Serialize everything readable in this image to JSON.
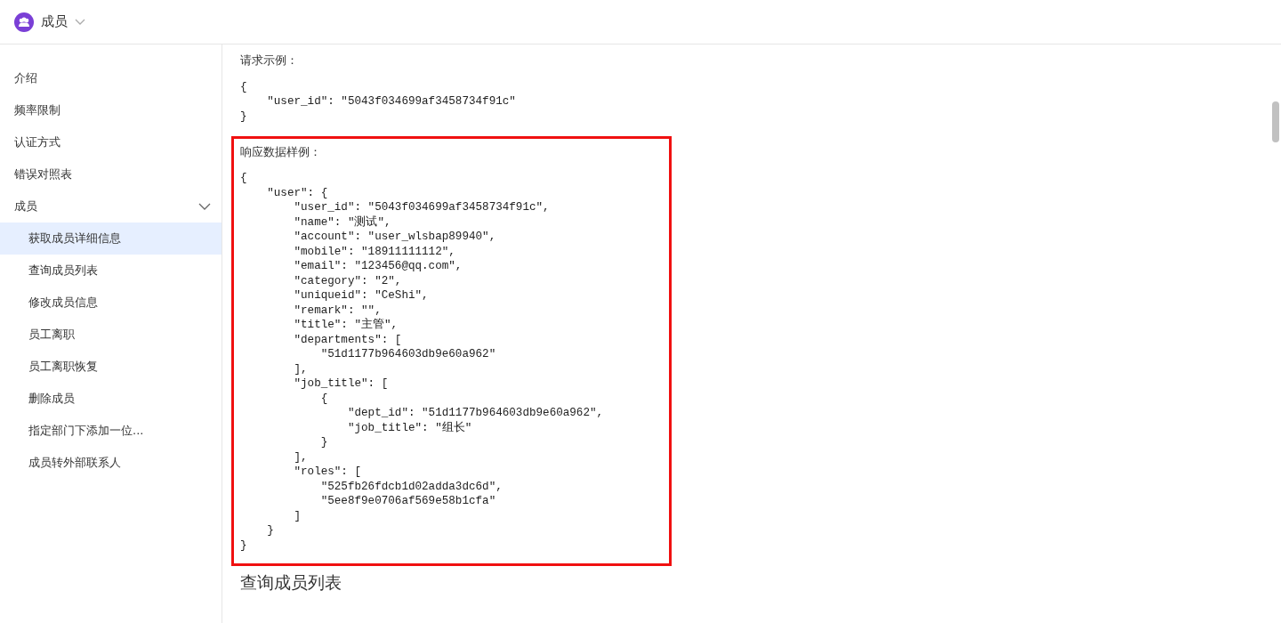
{
  "header": {
    "title": "成员"
  },
  "sidebar": {
    "items": [
      {
        "label": "介绍",
        "selected": false
      },
      {
        "label": "频率限制",
        "selected": false
      },
      {
        "label": "认证方式",
        "selected": false
      },
      {
        "label": "错误对照表",
        "selected": false
      },
      {
        "label": "成员",
        "selected": false,
        "expanded": true,
        "children": [
          {
            "label": "获取成员详细信息",
            "selected": true
          },
          {
            "label": "查询成员列表",
            "selected": false
          },
          {
            "label": "修改成员信息",
            "selected": false
          },
          {
            "label": "员工离职",
            "selected": false
          },
          {
            "label": "员工离职恢复",
            "selected": false
          },
          {
            "label": "删除成员",
            "selected": false
          },
          {
            "label": "指定部门下添加一位...",
            "selected": false
          },
          {
            "label": "成员转外部联系人",
            "selected": false
          }
        ]
      }
    ]
  },
  "content": {
    "blocks": [
      {
        "label": "请求示例：",
        "highlighted": false,
        "code": [
          "{",
          "    \"user_id\": \"5043f034699af3458734f91c\"",
          "}"
        ]
      },
      {
        "label": "响应数据样例：",
        "highlighted": true,
        "code": [
          "{",
          "    \"user\": {",
          "        \"user_id\": \"5043f034699af3458734f91c\",",
          "        \"name\": \"测试\",",
          "        \"account\": \"user_wlsbap89940\",",
          "        \"mobile\": \"18911111112\",",
          "        \"email\": \"123456@qq.com\",",
          "        \"category\": \"2\",",
          "        \"uniqueid\": \"CeShi\",",
          "        \"remark\": \"\",",
          "        \"title\": \"主管\",",
          "        \"departments\": [",
          "            \"51d1177b964603db9e60a962\"",
          "        ],",
          "        \"job_title\": [",
          "            {",
          "                \"dept_id\": \"51d1177b964603db9e60a962\",",
          "                \"job_title\": \"组长\"",
          "            }",
          "        ],",
          "        \"roles\": [",
          "            \"525fb26fdcb1d02adda3dc6d\",",
          "            \"5ee8f9e0706af569e58b1cfa\"",
          "        ]",
          "    }",
          "}"
        ]
      }
    ],
    "next_heading": "查询成员列表"
  }
}
